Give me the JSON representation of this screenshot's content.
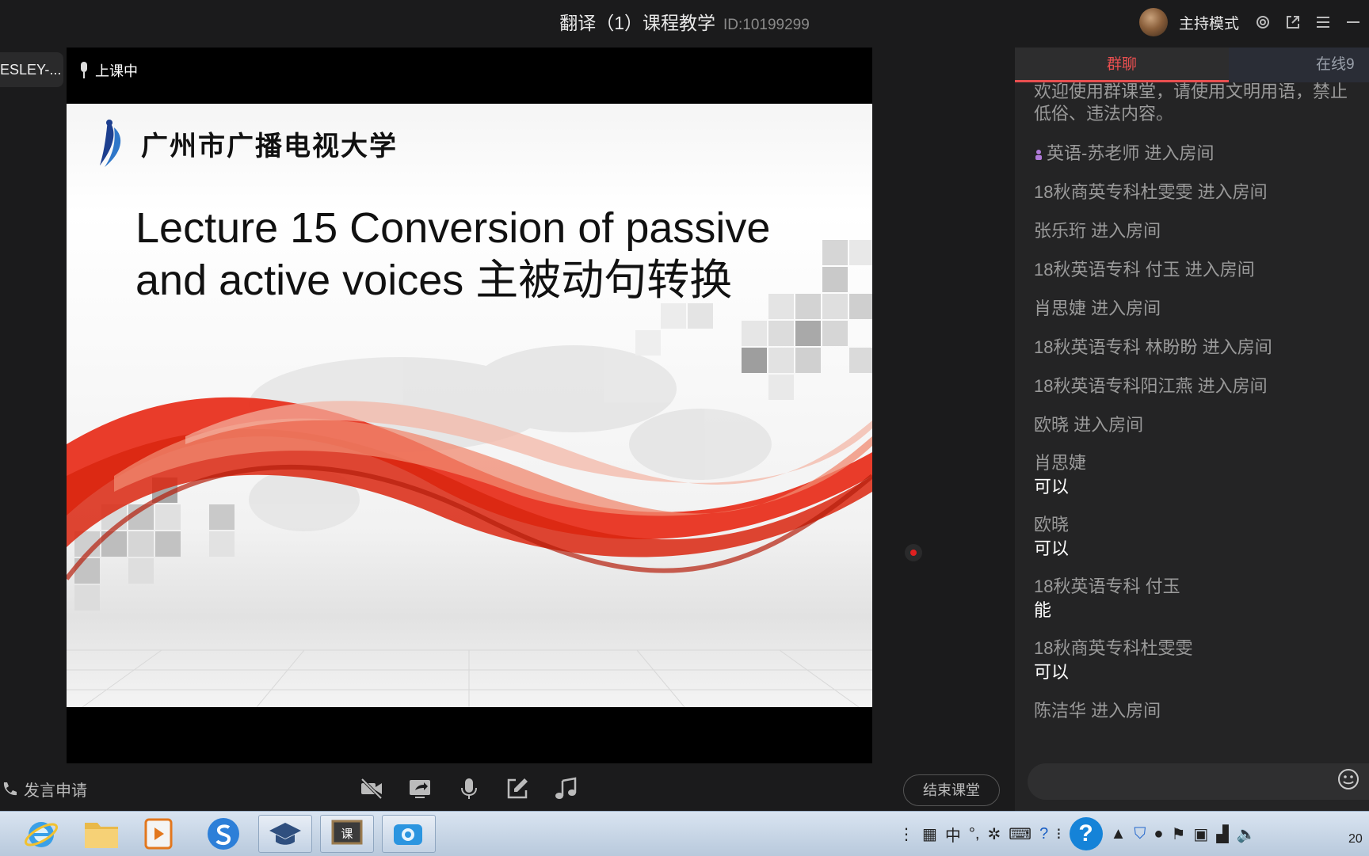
{
  "window": {
    "title": "翻译（1）课程教学",
    "meeting_id": "ID:10199299",
    "mode_label": "主持模式"
  },
  "left_tag": "ESLEY-...",
  "video": {
    "status": "上课中",
    "slide": {
      "university": "广州市广播电视大学",
      "title_line1": "Lecture 15 Conversion of passive",
      "title_line2": "and active voices 主被动句转换"
    }
  },
  "bottom_bar": {
    "speak_request": "发言申请",
    "end_class": "结束课堂"
  },
  "chat": {
    "tab_group": "群聊",
    "tab_online": "在线9",
    "notice": [
      "欢迎使用群课堂，请使用文明用语，禁止",
      "低俗、违法内容。"
    ],
    "entries": [
      {
        "name": "英语-苏老师",
        "action": "进入房间",
        "host": true
      },
      {
        "name": "18秋商英专科杜雯雯",
        "action": "进入房间"
      },
      {
        "name": "张乐珩",
        "action": "进入房间"
      },
      {
        "name": "18秋英语专科 付玉",
        "action": "进入房间"
      },
      {
        "name": "肖思婕",
        "action": "进入房间"
      },
      {
        "name": "18秋英语专科 林盼盼",
        "action": "进入房间"
      },
      {
        "name": "18秋英语专科阳江燕",
        "action": "进入房间"
      },
      {
        "name": "欧晓",
        "action": "进入房间"
      }
    ],
    "messages": [
      {
        "name": "肖思婕",
        "text": "可以"
      },
      {
        "name": "欧晓",
        "text": "可以"
      },
      {
        "name": "18秋英语专科 付玉",
        "text": "能"
      },
      {
        "name": "18秋商英专科杜雯雯",
        "text": "可以"
      }
    ],
    "last_entry": {
      "name": "陈洁华",
      "action": "进入房间"
    }
  },
  "taskbar": {
    "ime": "中",
    "clock": "20"
  },
  "colors": {
    "accent": "#e84f50",
    "background": "#1b1b1c",
    "panel": "#242425"
  }
}
